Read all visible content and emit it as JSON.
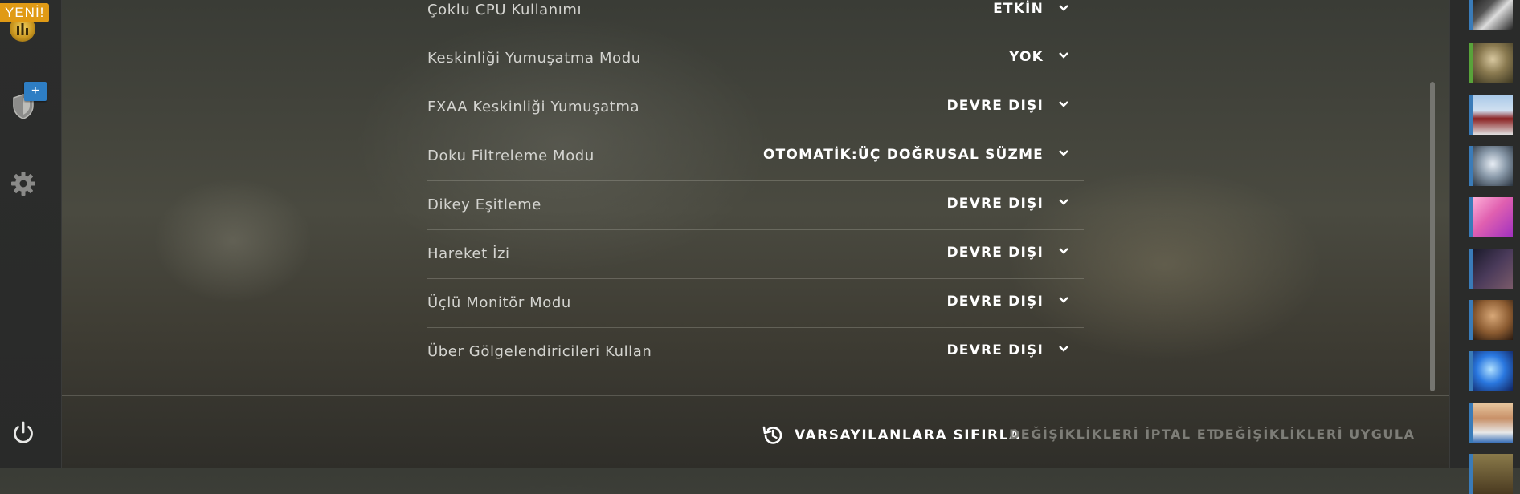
{
  "left_sidebar": {
    "new_badge": "YENİ!",
    "plus_badge": "+"
  },
  "settings": [
    {
      "label": "Çoklu CPU Kullanımı",
      "value": "ETKİN"
    },
    {
      "label": "Keskinliği Yumuşatma Modu",
      "value": "YOK"
    },
    {
      "label": "FXAA Keskinliği Yumuşatma",
      "value": "DEVRE DIŞI"
    },
    {
      "label": "Doku Filtreleme Modu",
      "value": "OTOMATİK:ÜÇ DOĞRUSAL SÜZME"
    },
    {
      "label": "Dikey Eşitleme",
      "value": "DEVRE DIŞI"
    },
    {
      "label": "Hareket İzi",
      "value": "DEVRE DIŞI"
    },
    {
      "label": "Üçlü Monitör Modu",
      "value": "DEVRE DIŞI"
    },
    {
      "label": "Über Gölgelendiricileri Kullan",
      "value": "DEVRE DIŞI"
    }
  ],
  "footer": {
    "reset_label": "VARSAYILANLARA SIFIRLA",
    "cancel_label": "DEĞİŞİKLİKLERİ İPTAL ET",
    "apply_label": "DEĞİŞİKLİKLERİ UYGULA"
  },
  "icons": {
    "rank": "rank-emblem-icon",
    "shield": "shield-icon",
    "gear": "gear-icon",
    "power": "power-icon",
    "chevron": "chevron-down-icon",
    "reset": "history-icon"
  },
  "colors": {
    "accent_orange": "#e09a15",
    "accent_blue": "#2e7ec4",
    "online_green": "#58a33a",
    "friend_blue": "#3a7bb8",
    "disabled_text": "#7d7d77"
  }
}
